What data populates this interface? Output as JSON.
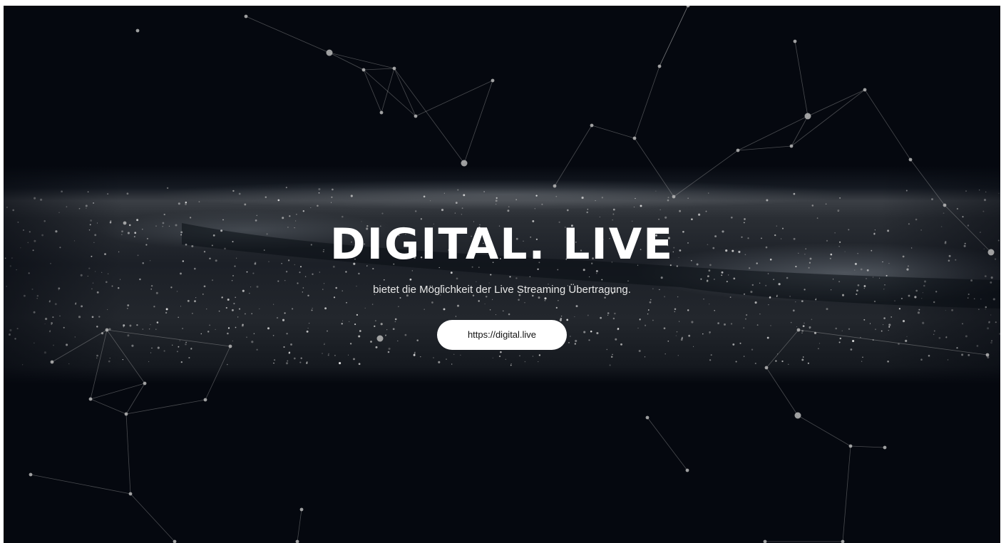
{
  "hero": {
    "title": "DIGITAL. LIVE",
    "subtitle": "bietet die Möglichkeit der Live Streaming Übertragung.",
    "link_label": "https://digital.live"
  },
  "colors": {
    "background": "#05080f",
    "text": "#ffffff",
    "button_background": "#ffffff",
    "button_text": "#111111"
  }
}
